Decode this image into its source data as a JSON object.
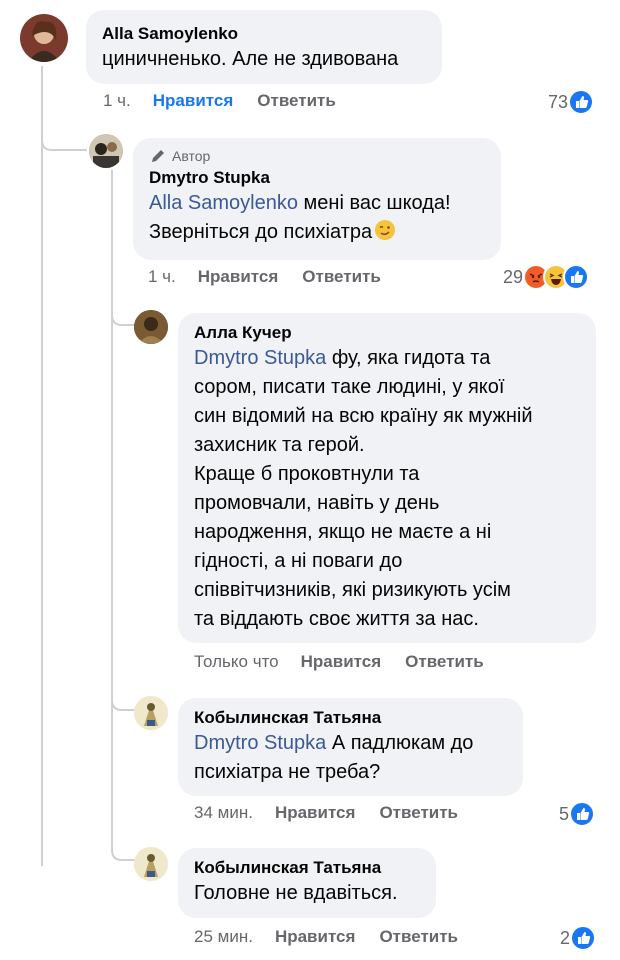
{
  "accent_color": "#1877f2",
  "mention_color": "#3b5998",
  "labels": {
    "like": "Нравится",
    "reply": "Ответить",
    "author": "Автор"
  },
  "comments": [
    {
      "name": "Alla Samoylenko",
      "text": "циничненько. Але не здивована",
      "time": "1 ч.",
      "liked": true,
      "reaction_count": "73",
      "reactions": [
        "like-icon"
      ]
    },
    {
      "name": "Dmytro Stupka",
      "author_badge": true,
      "mention": "Alla Samoylenko",
      "text": " мені вас шкода!\nЗверніться до психіатра",
      "emoji": "winking-face-icon",
      "time": "1 ч.",
      "liked": false,
      "reaction_count": "29",
      "reactions": [
        "angry-icon",
        "haha-icon",
        "like-icon"
      ]
    },
    {
      "name": "Алла Кучер",
      "mention": "Dmytro Stupka",
      "text": " фу, яка гидота та\nсором, писати таке людині, у якої\nсин відомий на всю країну як мужній\nзахисник та герой.\nКраще б проковтнули та\nпромовчали, навіть у день\nнародження, якщо не маєте а ні\nгідності, а ні поваги до\nспіввітчизників, які ризикують усім\nта віддають своє життя за нас.",
      "time": "Только что",
      "liked": false
    },
    {
      "name": "Кобылинская Татьяна",
      "mention": "Dmytro Stupka",
      "text": " А падлюкам до\nпсихіатра не треба?",
      "time": "34 мин.",
      "liked": false,
      "reaction_count": "5",
      "reactions": [
        "like-icon"
      ]
    },
    {
      "name": "Кобылинская Татьяна",
      "text": "Головне не вдавіться.",
      "time": "25 мин.",
      "liked": false,
      "reaction_count": "2",
      "reactions": [
        "like-icon"
      ]
    }
  ]
}
